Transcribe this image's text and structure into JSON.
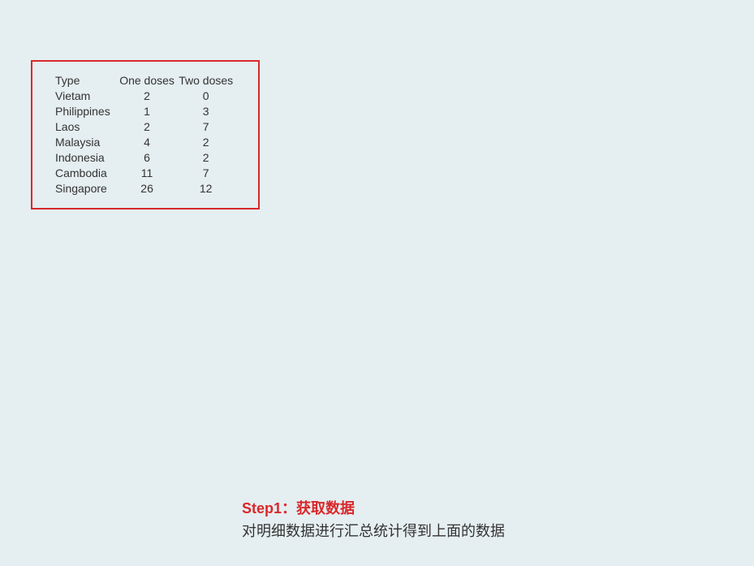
{
  "table": {
    "headers": {
      "type": "Type",
      "one_doses": "One doses",
      "two_doses": "Two doses"
    },
    "rows": [
      {
        "type": "Vietam",
        "one": "2",
        "two": "0"
      },
      {
        "type": "Philippines",
        "one": "1",
        "two": "3"
      },
      {
        "type": "Laos",
        "one": "2",
        "two": "7"
      },
      {
        "type": "Malaysia",
        "one": "4",
        "two": "2"
      },
      {
        "type": "Indonesia",
        "one": "6",
        "two": "2"
      },
      {
        "type": "Cambodia",
        "one": "11",
        "two": "7"
      },
      {
        "type": "Singapore",
        "one": "26",
        "two": "12"
      }
    ]
  },
  "caption": {
    "title": "Step1：获取数据",
    "subtitle": "对明细数据进行汇总统计得到上面的数据"
  }
}
